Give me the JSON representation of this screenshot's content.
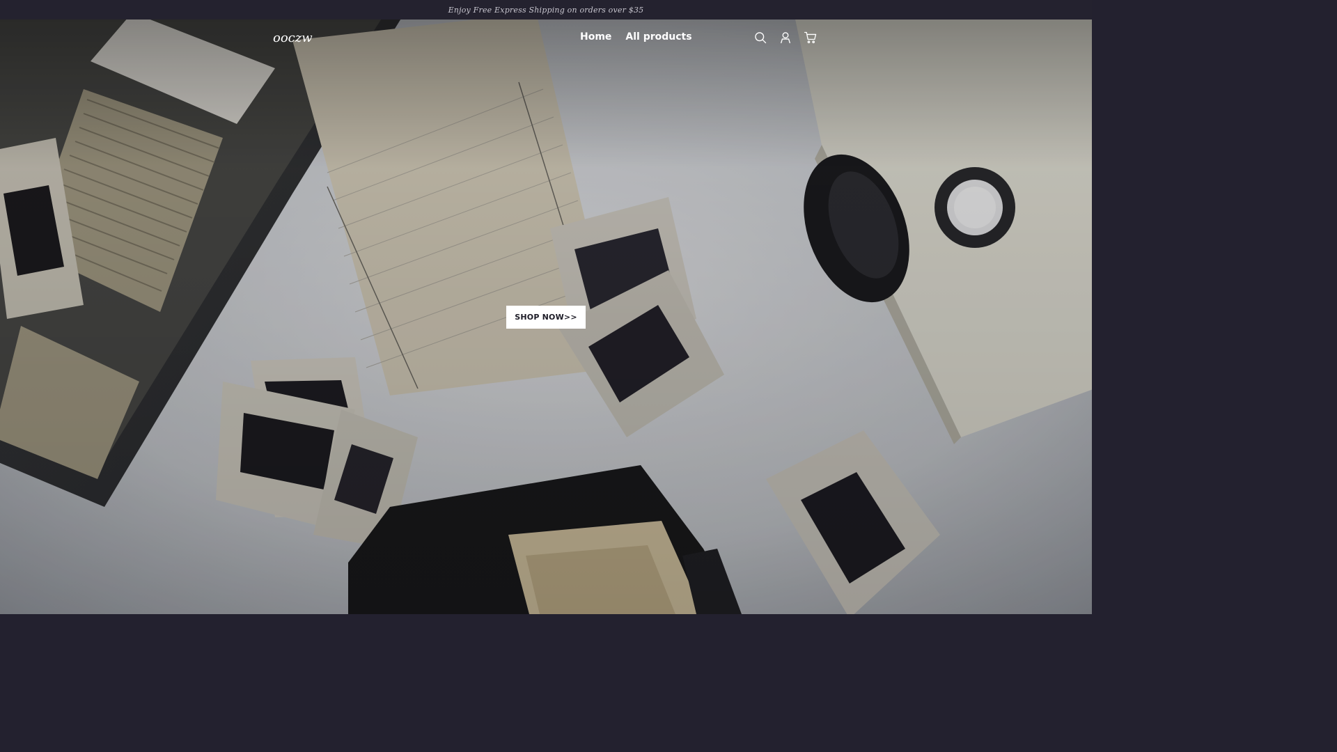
{
  "announcement": {
    "text": "Enjoy Free Express Shipping on orders over $35"
  },
  "header": {
    "logo": "ooczw",
    "nav": [
      {
        "label": "Home"
      },
      {
        "label": "All products"
      }
    ],
    "icons": [
      "search-icon",
      "account-icon",
      "cart-icon"
    ]
  },
  "hero": {
    "cta_label": "SHOP NOW>>"
  },
  "colors": {
    "announcement_bg": "#24222f",
    "cta_bg": "#ffffff",
    "header_text": "#ffffff"
  }
}
